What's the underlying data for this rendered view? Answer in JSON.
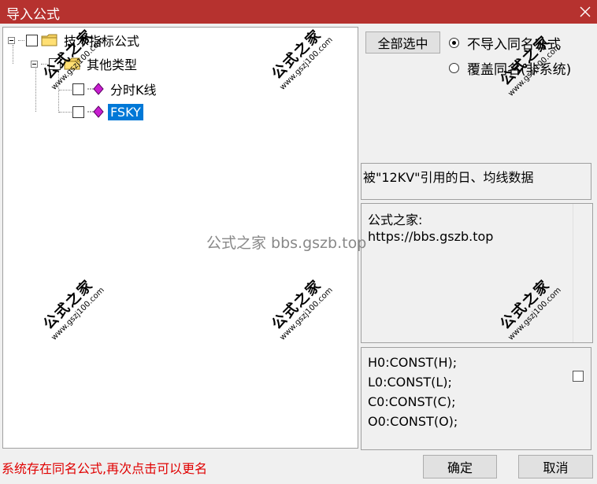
{
  "window": {
    "title": "导入公式"
  },
  "tree": {
    "root": {
      "label": "技术指标公式"
    },
    "group": {
      "label": "其他类型"
    },
    "items": [
      {
        "label": "分时K线",
        "selected": false
      },
      {
        "label": "FSKY",
        "selected": true
      }
    ]
  },
  "controls": {
    "select_all": "全部选中",
    "radio_no_import": "不导入同名公式",
    "radio_overwrite": "覆盖同名(非系统)",
    "radio_selected": "no_import"
  },
  "description": "被\"12KV\"引用的日、均线数据",
  "info": {
    "line1": "公式之家:",
    "line2": "https://bbs.gszb.top"
  },
  "code_lines": [
    "H0:CONST(H);",
    "L0:CONST(L);",
    "C0:CONST(C);",
    "O0:CONST(O);"
  ],
  "status_text": "系统存在同名公式,再次点击可以更名",
  "buttons": {
    "ok": "确定",
    "cancel": "取消"
  },
  "watermark": {
    "center": "公式之家 bbs.gszb.top",
    "stamp_cn": "公式之家",
    "stamp_url": "www.gszj100.com"
  },
  "colors": {
    "titlebar": "#b6322f",
    "selection": "#0078d7",
    "status": "#e00000"
  }
}
